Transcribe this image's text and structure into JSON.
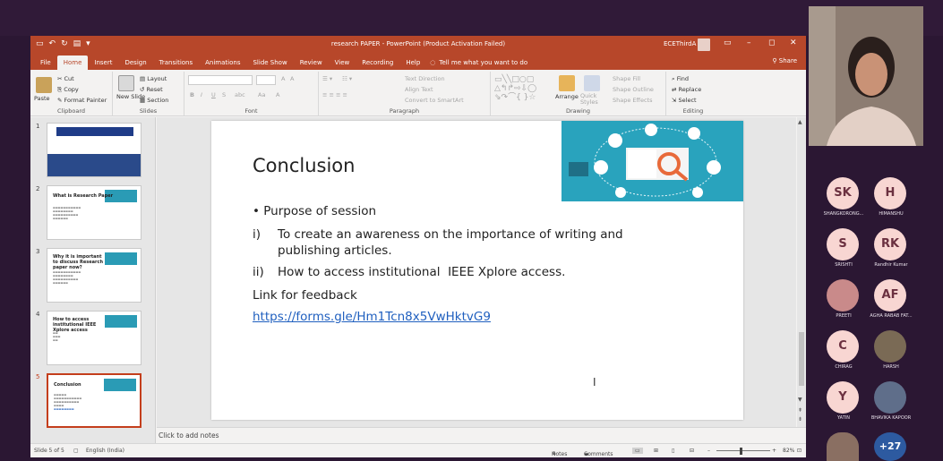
{
  "window": {
    "title": "research PAPER - PowerPoint (Product Activation Failed)",
    "user": "ECEThirdA",
    "share_label": "Share"
  },
  "menu_tabs": [
    "File",
    "Home",
    "Insert",
    "Design",
    "Transitions",
    "Animations",
    "Slide Show",
    "Review",
    "View",
    "Recording",
    "Help"
  ],
  "tell_me": "Tell me what you want to do",
  "ribbon": {
    "clipboard": {
      "paste": "Paste",
      "cut": "Cut",
      "copy": "Copy",
      "format_painter": "Format Painter",
      "label": "Clipboard"
    },
    "slides": {
      "new_slide": "New Slide",
      "layout": "Layout",
      "reset": "Reset",
      "section": "Section",
      "label": "Slides"
    },
    "font": {
      "label": "Font",
      "bold": "B",
      "italic": "I",
      "underline": "U",
      "strike": "S",
      "spacing": "abc",
      "grow": "A",
      "shrink": "A",
      "case": "Aa",
      "color": "A"
    },
    "paragraph": {
      "label": "Paragraph",
      "text_direction": "Text Direction",
      "align_text": "Align Text",
      "smartart": "Convert to SmartArt"
    },
    "drawing": {
      "label": "Drawing",
      "arrange": "Arrange",
      "quick_styles": "Quick Styles",
      "shape_fill": "Shape Fill",
      "shape_outline": "Shape Outline",
      "shape_effects": "Shape Effects"
    },
    "editing": {
      "label": "Editing",
      "find": "Find",
      "replace": "Replace",
      "select": "Select"
    }
  },
  "thumbnails": [
    {
      "num": "1",
      "title": ""
    },
    {
      "num": "2",
      "title": "What is Research Paper"
    },
    {
      "num": "3",
      "title": "Why it is important to discuss Research paper now?"
    },
    {
      "num": "4",
      "title": "How to access institutional IEEE Xplore access"
    },
    {
      "num": "5",
      "title": "Conclusion"
    }
  ],
  "slide": {
    "title": "Conclusion",
    "bullet": "Purpose of session",
    "items": [
      {
        "num": "i)",
        "text": "To create an awareness on the importance of writing and publishing articles."
      },
      {
        "num": "ii)",
        "text": "How to access institutional  IEEE Xplore access."
      }
    ],
    "link_label": "Link for feedback",
    "link": "https://forms.gle/Hm1Tcn8x5VwHktvG9"
  },
  "notes_placeholder": "Click to add notes",
  "status": {
    "slide_of": "Slide 5 of 5",
    "language": "English (India)",
    "notes": "Notes",
    "comments": "Comments",
    "zoom": "82%"
  },
  "participants": [
    {
      "initials": "SK",
      "name": "SHANGKORONG..."
    },
    {
      "initials": "H",
      "name": "HIMANSHU"
    },
    {
      "initials": "S",
      "name": "SRISHTI"
    },
    {
      "initials": "RK",
      "name": "Randhir Kumar"
    },
    {
      "initials": "",
      "name": "PREETI"
    },
    {
      "initials": "AF",
      "name": "AGHA RABAB FAT..."
    },
    {
      "initials": "C",
      "name": "CHIRAG"
    },
    {
      "initials": "",
      "name": "HARSH"
    },
    {
      "initials": "Y",
      "name": "YATIN"
    },
    {
      "initials": "",
      "name": "BHAVIKA KAPOOR"
    },
    {
      "initials": "",
      "name": ""
    },
    {
      "initials": "+27",
      "name": ""
    }
  ],
  "colors": {
    "ppt_accent": "#b7472a",
    "avatar_bg": "#f8d6d2",
    "link": "#1f5fbf",
    "background": "#2b1733"
  }
}
